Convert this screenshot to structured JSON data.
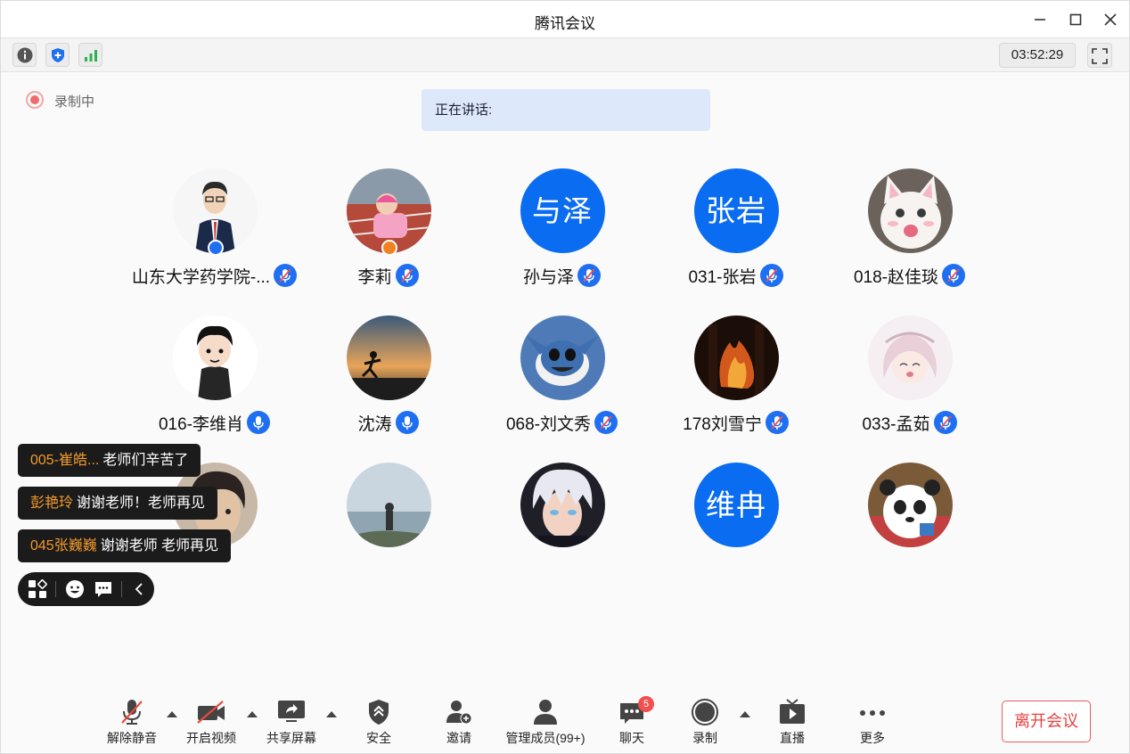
{
  "window": {
    "title": "腾讯会议"
  },
  "toolbar": {
    "timer": "03:52:29"
  },
  "status": {
    "recording_label": "录制中",
    "speaking_label": "正在讲话:"
  },
  "participants": [
    {
      "name": "山东大学药学院-...",
      "avatar": "photo-man-suit",
      "muted": true,
      "badge": "host"
    },
    {
      "name": "李莉",
      "avatar": "photo-child-track",
      "muted": true,
      "badge": "cohost"
    },
    {
      "name": "孙与泽",
      "avatar_text": "与泽",
      "muted": true
    },
    {
      "name": "031-张岩",
      "avatar_text": "张岩",
      "muted": true
    },
    {
      "name": "018-赵佳琰",
      "avatar": "photo-cat",
      "muted": true
    },
    {
      "name": "016-李维肖",
      "avatar": "photo-cartoon-boy",
      "muted": false
    },
    {
      "name": "沈涛",
      "avatar": "photo-runner-sunset",
      "muted": false
    },
    {
      "name": "068-刘文秀",
      "avatar": "photo-stitch",
      "muted": true
    },
    {
      "name": "178刘雪宁",
      "avatar": "photo-fire",
      "muted": true
    },
    {
      "name": "033-孟茹",
      "avatar": "photo-anime-girl",
      "muted": true
    },
    {
      "name": "",
      "avatar": "photo-boy-face"
    },
    {
      "name": "",
      "avatar": "photo-person-sea"
    },
    {
      "name": "",
      "avatar": "photo-anime-white-hair"
    },
    {
      "name": "",
      "avatar_text": "维冉"
    },
    {
      "name": "",
      "avatar": "photo-panda-bear"
    }
  ],
  "chat_messages": [
    {
      "sender": "005-崔皓...",
      "text": "老师们辛苦了"
    },
    {
      "sender": "彭艳玲",
      "text": "谢谢老师！老师再见"
    },
    {
      "sender": "045张巍巍",
      "text": "谢谢老师 老师再见"
    }
  ],
  "bottom_bar": {
    "unmute": "解除静音",
    "start_video": "开启视频",
    "share_screen": "共享屏幕",
    "security": "安全",
    "invite": "邀请",
    "manage_members": "管理成员(99+)",
    "chat": "聊天",
    "chat_badge": "5",
    "record": "录制",
    "live": "直播",
    "more": "更多",
    "leave": "离开会议"
  },
  "colors": {
    "accent": "#0a6cf1",
    "leave": "#ea4040",
    "chat_sender": "#f39a2c"
  }
}
